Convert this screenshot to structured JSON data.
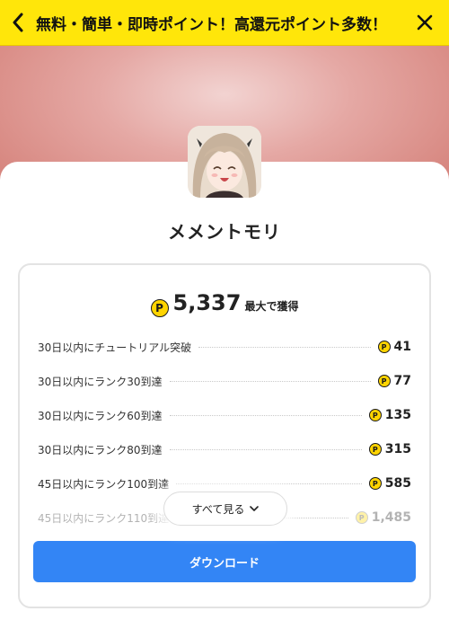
{
  "header": {
    "title": "無料・簡単・即時ポイント！高還元ポイント多数！"
  },
  "app": {
    "name": "メメントモリ"
  },
  "reward": {
    "total": "5,337",
    "suffix": "最大で獲得",
    "coin_symbol": "P"
  },
  "tasks": [
    {
      "label": "30日以内にチュートリアル突破",
      "points": "41"
    },
    {
      "label": "30日以内にランク30到達",
      "points": "77"
    },
    {
      "label": "30日以内にランク60到達",
      "points": "135"
    },
    {
      "label": "30日以内にランク80到達",
      "points": "315"
    },
    {
      "label": "45日以内にランク100到達",
      "points": "585"
    },
    {
      "label": "45日以内にランク110到達",
      "points": "1,485"
    }
  ],
  "see_all_label": "すべて見る",
  "download_label": "ダウンロード",
  "colors": {
    "header_bg": "#ffe60a",
    "coin": "#ffd400",
    "button": "#3385f5"
  }
}
